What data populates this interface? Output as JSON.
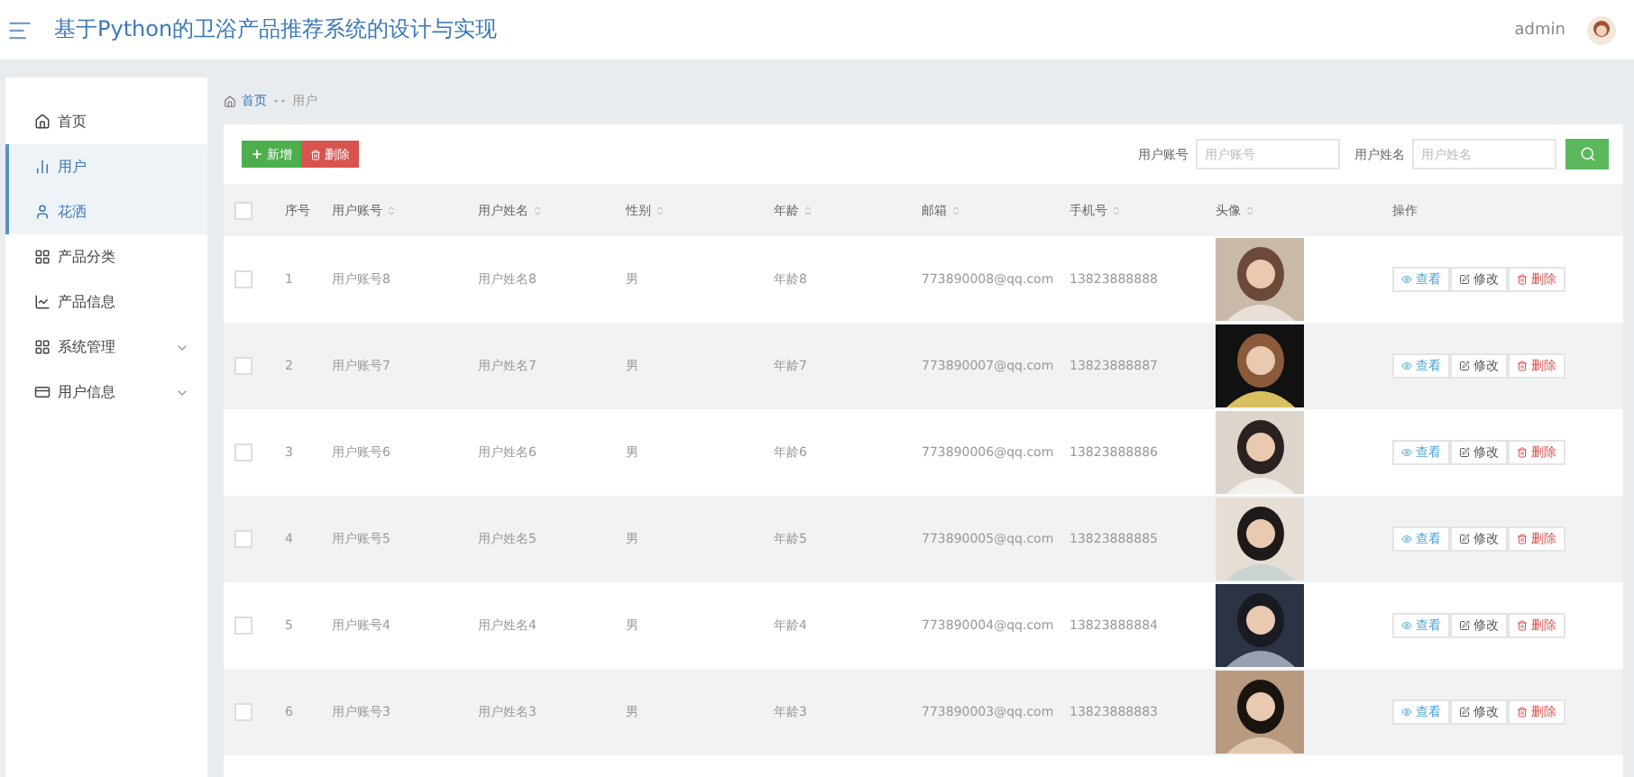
{
  "header": {
    "title": "基于Python的卫浴产品推荐系统的设计与实现",
    "user": "admin"
  },
  "sidebar": {
    "items": [
      {
        "label": "首页",
        "kind": "home",
        "selected": false,
        "expandable": false
      },
      {
        "label": "用户",
        "kind": "chart",
        "selected": true,
        "expandable": false
      },
      {
        "label": "花洒",
        "kind": "person",
        "selected": true,
        "expandable": false
      },
      {
        "label": "产品分类",
        "kind": "grid",
        "selected": false,
        "expandable": false
      },
      {
        "label": "产品信息",
        "kind": "trend",
        "selected": false,
        "expandable": false
      },
      {
        "label": "系统管理",
        "kind": "grid",
        "selected": false,
        "expandable": true
      },
      {
        "label": "用户信息",
        "kind": "card",
        "selected": false,
        "expandable": true
      }
    ]
  },
  "breadcrumb": [
    "首页",
    "用户"
  ],
  "toolbar": {
    "add": "新增",
    "delete": "删除",
    "filters": [
      {
        "label": "用户账号",
        "placeholder": "用户账号"
      },
      {
        "label": "用户姓名",
        "placeholder": "用户姓名"
      }
    ]
  },
  "table": {
    "select_all_checked": false,
    "columns": [
      {
        "label": "序号",
        "sortable": false
      },
      {
        "label": "用户账号",
        "sortable": true
      },
      {
        "label": "用户姓名",
        "sortable": true
      },
      {
        "label": "性别",
        "sortable": true
      },
      {
        "label": "年龄",
        "sortable": true
      },
      {
        "label": "邮箱",
        "sortable": true
      },
      {
        "label": "手机号",
        "sortable": true
      },
      {
        "label": "头像",
        "sortable": true
      },
      {
        "label": "操作",
        "sortable": false
      }
    ],
    "rows": [
      {
        "no": "1",
        "account": "用户账号8",
        "name": "用户姓名8",
        "gender": "男",
        "age": "年龄8",
        "email": "773890008@qq.com",
        "phone": "13823888888",
        "checked": false,
        "actions": [
          "查看",
          "修改",
          "删除"
        ]
      },
      {
        "no": "2",
        "account": "用户账号7",
        "name": "用户姓名7",
        "gender": "男",
        "age": "年龄7",
        "email": "773890007@qq.com",
        "phone": "13823888887",
        "checked": false,
        "actions": [
          "查看",
          "修改",
          "删除"
        ]
      },
      {
        "no": "3",
        "account": "用户账号6",
        "name": "用户姓名6",
        "gender": "男",
        "age": "年龄6",
        "email": "773890006@qq.com",
        "phone": "13823888886",
        "checked": false,
        "actions": [
          "查看",
          "修改",
          "删除"
        ]
      },
      {
        "no": "4",
        "account": "用户账号5",
        "name": "用户姓名5",
        "gender": "男",
        "age": "年龄5",
        "email": "773890005@qq.com",
        "phone": "13823888885",
        "checked": false,
        "actions": [
          "查看",
          "修改",
          "删除"
        ]
      },
      {
        "no": "5",
        "account": "用户账号4",
        "name": "用户姓名4",
        "gender": "男",
        "age": "年龄4",
        "email": "773890004@qq.com",
        "phone": "13823888884",
        "checked": false,
        "actions": [
          "查看",
          "修改",
          "删除"
        ]
      },
      {
        "no": "6",
        "account": "用户账号3",
        "name": "用户姓名3",
        "gender": "男",
        "age": "年龄3",
        "email": "773890003@qq.com",
        "phone": "13823888883",
        "checked": false,
        "actions": [
          "查看",
          "修改",
          "删除"
        ]
      }
    ]
  }
}
